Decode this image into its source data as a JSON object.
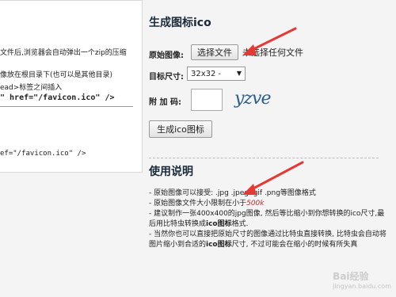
{
  "left_panel": {
    "lines": [
      "文件后,浏览器会自动弹出一个zip的压缩",
      "像放在根目录下(也可以是其他目录)",
      "ead>标签之间插入",
      "\" href=\"/favicon.ico\" />",
      "ef=\"/favicon.ico\" />"
    ]
  },
  "form": {
    "title": "生成图标ico",
    "original_label": "原始图像:",
    "choose_file_button": "选择文件",
    "file_status": "未选择任何文件",
    "size_label": "目标尺寸:",
    "size_value": "32x32  -",
    "captcha_label": "附 加 码:",
    "captcha_text": "yzve",
    "generate_button": "生成ico图标"
  },
  "usage": {
    "title": "使用说明",
    "items": [
      "- 原始图像可以接受: .jpg .jpeg .gif .png等图像格式",
      "- 原始图像文件大小限制在小于",
      "500k",
      "- 建议制作一张400x400的jpg图像, 然后等比缩小到你想转换的ico尺寸,最后用比特虫转换成",
      "ico图标",
      "格式.",
      "- 当然你也可以直接把原始尺寸的图像通过比特虫直接转换, 比特虫会自动将图片缩小到合适的",
      "ico图标",
      "尺寸, 不过可能会在缩小的时候有所失真"
    ]
  },
  "watermark": {
    "text": "Bai经验",
    "sub": "jingyan.baidu.com"
  },
  "colors": {
    "accent_red": "#e53935",
    "title": "#1a2a3a"
  }
}
